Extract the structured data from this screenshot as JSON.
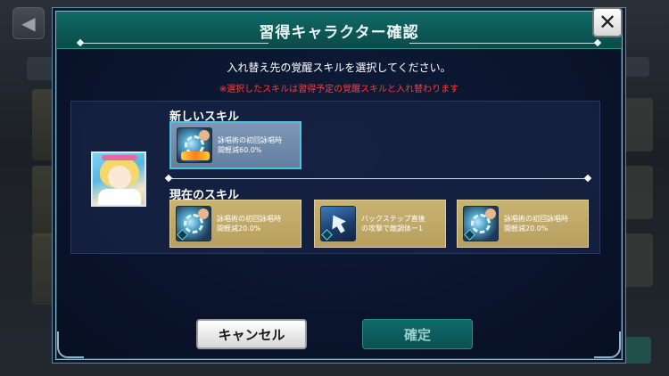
{
  "modal": {
    "title": "習得キャラクター確認",
    "instruction": "入れ替え先の覚醒スキルを選択してください。",
    "warning": "※選択したスキルは習得予定の覚醒スキルと入れ替わります",
    "close_label": "✕"
  },
  "new_section": {
    "label": "新しいスキル",
    "skill": {
      "text": "詠唱術の初回詠唱時\n間軽減60.0%",
      "icon": "gear-hand-icon"
    }
  },
  "current_section": {
    "label": "現在のスキル",
    "skills": [
      {
        "text": "詠唱術の初回詠唱時\n間軽減20.0%",
        "icon": "gear-hand-icon"
      },
      {
        "text": "バックステップ直後\nの攻撃で敵調体ー1",
        "icon": "backstep-arrow-icon"
      },
      {
        "text": "詠唱術の初回詠唱時\n間軽減20.0%",
        "icon": "gear-hand-icon"
      }
    ]
  },
  "buttons": {
    "cancel": "キャンセル",
    "confirm": "確定"
  },
  "background": {
    "back_label": "◀"
  },
  "colors": {
    "header": "#0f6a66",
    "warning": "#ff3c3c",
    "skill_gold": "#c9b373",
    "skill_new": "#7e97b8",
    "confirm": "#0e6a6a"
  }
}
